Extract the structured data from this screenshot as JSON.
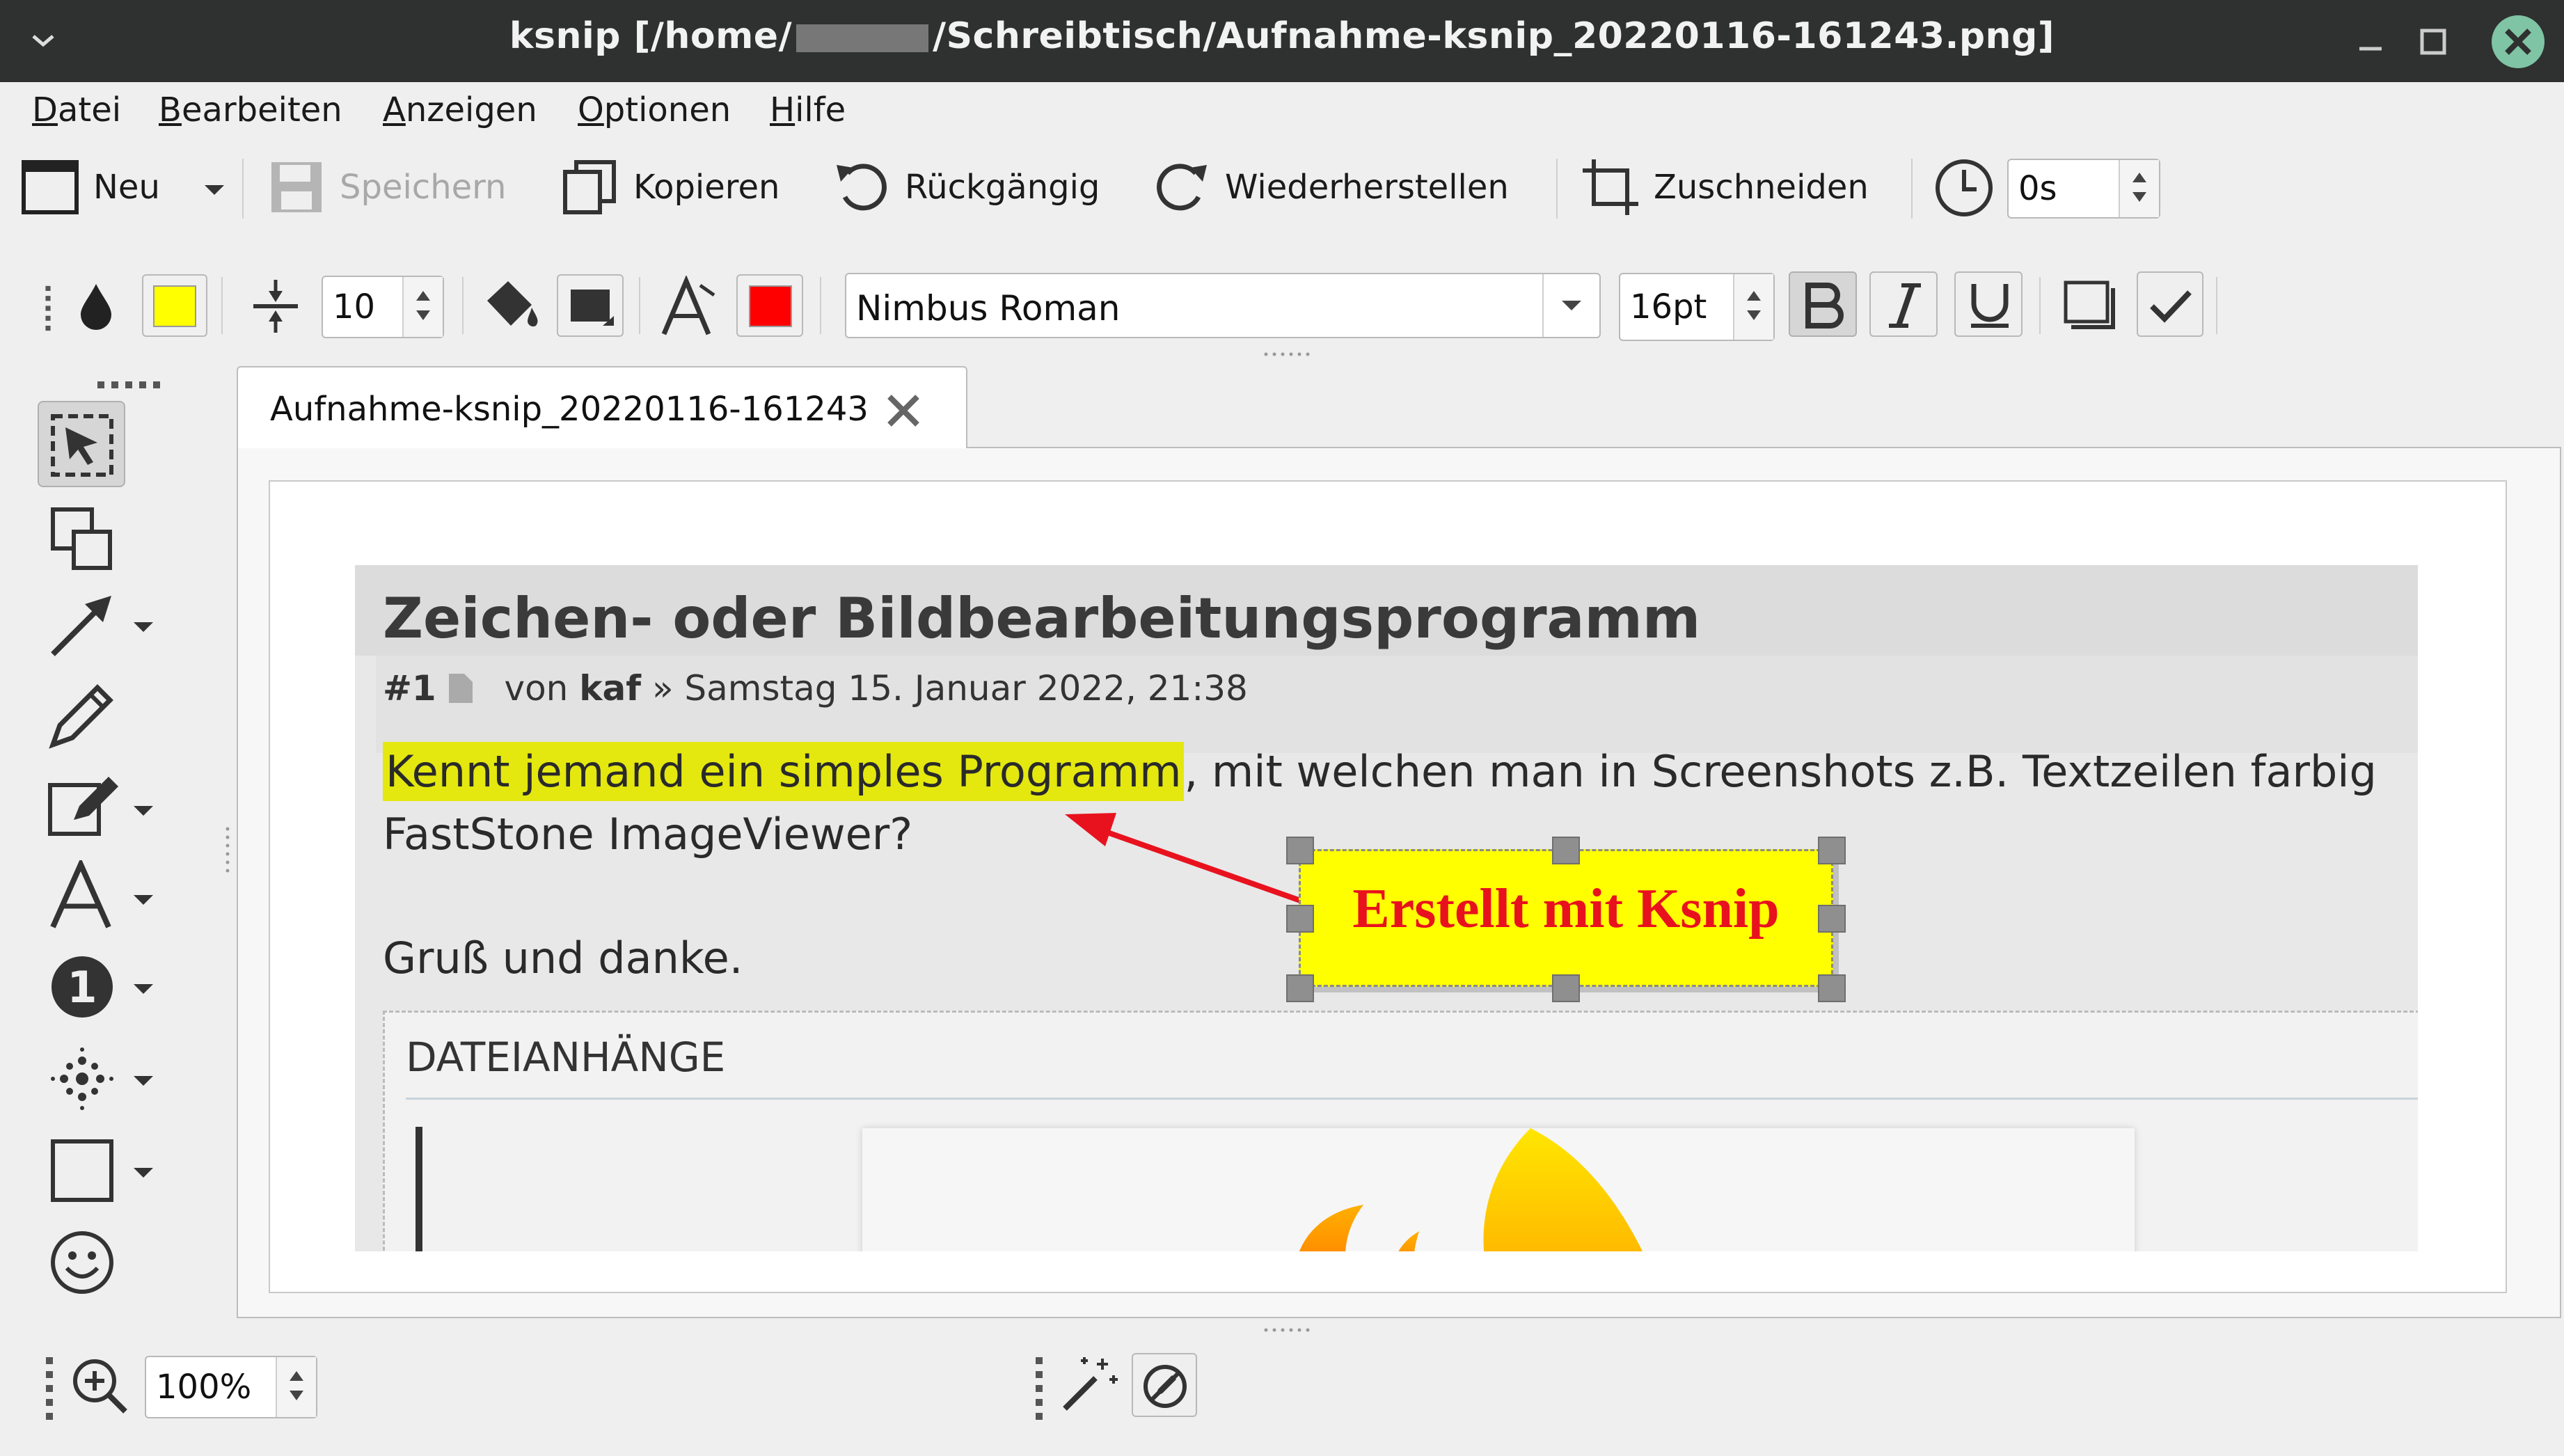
{
  "window": {
    "title_prefix": "ksnip [/home/",
    "title_suffix": "/Schreibtisch/Aufnahme-ksnip_20220116-161243.png]"
  },
  "menu": {
    "items": [
      {
        "mnemonic": "D",
        "rest": "atei"
      },
      {
        "mnemonic": "B",
        "rest": "earbeiten"
      },
      {
        "mnemonic": "A",
        "rest": "nzeigen"
      },
      {
        "mnemonic": "O",
        "rest": "ptionen"
      },
      {
        "mnemonic": "H",
        "rest": "ilfe"
      }
    ]
  },
  "toolbar": {
    "new_label": "Neu",
    "save_label": "Speichern",
    "copy_label": "Kopieren",
    "undo_label": "Rückgängig",
    "redo_label": "Wiederherstellen",
    "crop_label": "Zuschneiden",
    "delay_value": "0s"
  },
  "properties": {
    "fill_color": "#ffff00",
    "stroke_color": "#ff0000",
    "width_value": "10",
    "font_name": "Nimbus Roman",
    "font_size": "16pt"
  },
  "tab": {
    "label": "Aufnahme-ksnip_20220116-161243"
  },
  "screenshot": {
    "heading": "Zeichen- oder Bildbearbeitungsprogramm",
    "post_number": "#1",
    "meta_von": "von",
    "meta_author": "kaf",
    "meta_date": "» Samstag 15. Januar 2022, 21:38",
    "highlighted_text": "Kennt jemand ein simples Programm",
    "line1_rest": ", mit welchen man in Screenshots z.B. Textzeilen farbig",
    "line2": "FastStone ImageViewer?",
    "line3": "Gruß und danke.",
    "attachments_label": "DATEIANHÄNGE"
  },
  "annotation": {
    "text": "Erstellt mit Ksnip"
  },
  "bottom": {
    "zoom_value": "100%"
  }
}
